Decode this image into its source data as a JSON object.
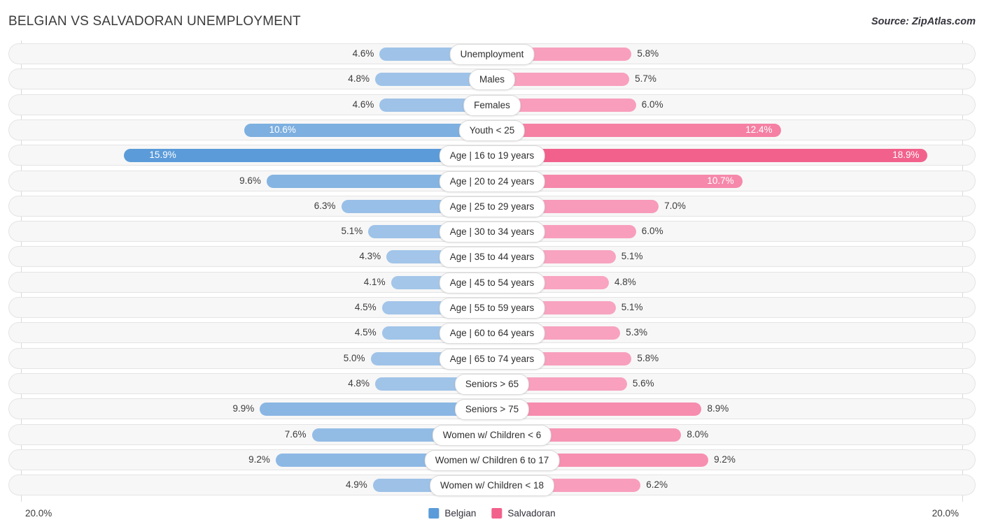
{
  "header": {
    "title": "BELGIAN VS SALVADORAN UNEMPLOYMENT",
    "source": "Source: ZipAtlas.com"
  },
  "axis": {
    "left_label": "20.0%",
    "right_label": "20.0%"
  },
  "legend": {
    "items": [
      {
        "label": "Belgian",
        "color": "#5b9bd9"
      },
      {
        "label": "Salvadoran",
        "color": "#f2618c"
      }
    ]
  },
  "colors": {
    "belgian_light": "#a8c8ea",
    "belgian_dark": "#5b9bd9",
    "salvadoran_light": "#f9a8c4",
    "salvadoran_dark": "#f2618c",
    "track": "#f7f7f7",
    "gridline": "#d8d8d8"
  },
  "chart_data": {
    "type": "bar",
    "title": "BELGIAN VS SALVADORAN UNEMPLOYMENT",
    "subtitle": "Source: ZipAtlas.com",
    "orientation": "horizontal",
    "style": "diverging-bidirectional",
    "xlabel": "",
    "ylabel": "",
    "xlim": [
      0,
      20
    ],
    "axis_ticks": [
      "20.0%",
      "20.0%"
    ],
    "grid": true,
    "legend_position": "bottom-center",
    "unit": "%",
    "max_value": 20.0,
    "categories": [
      "Unemployment",
      "Males",
      "Females",
      "Youth < 25",
      "Age | 16 to 19 years",
      "Age | 20 to 24 years",
      "Age | 25 to 29 years",
      "Age | 30 to 34 years",
      "Age | 35 to 44 years",
      "Age | 45 to 54 years",
      "Age | 55 to 59 years",
      "Age | 60 to 64 years",
      "Age | 65 to 74 years",
      "Seniors > 65",
      "Seniors > 75",
      "Women w/ Children < 6",
      "Women w/ Children 6 to 17",
      "Women w/ Children < 18"
    ],
    "series": [
      {
        "name": "Belgian",
        "color": "#5b9bd9",
        "values": [
          4.6,
          4.8,
          4.6,
          10.6,
          15.9,
          9.6,
          6.3,
          5.1,
          4.3,
          4.1,
          4.5,
          4.5,
          5.0,
          4.8,
          9.9,
          7.6,
          9.2,
          4.9
        ],
        "labels": [
          "4.6%",
          "4.8%",
          "4.6%",
          "10.6%",
          "15.9%",
          "9.6%",
          "6.3%",
          "5.1%",
          "4.3%",
          "4.1%",
          "4.5%",
          "4.5%",
          "5.0%",
          "4.8%",
          "9.9%",
          "7.6%",
          "9.2%",
          "4.9%"
        ]
      },
      {
        "name": "Salvadoran",
        "color": "#f2618c",
        "values": [
          5.8,
          5.7,
          6.0,
          12.4,
          18.9,
          10.7,
          7.0,
          6.0,
          5.1,
          4.8,
          5.1,
          5.3,
          5.8,
          5.6,
          8.9,
          8.0,
          9.2,
          6.2
        ],
        "labels": [
          "5.8%",
          "5.7%",
          "6.0%",
          "12.4%",
          "18.9%",
          "10.7%",
          "7.0%",
          "6.0%",
          "5.1%",
          "4.8%",
          "5.1%",
          "5.3%",
          "5.8%",
          "5.6%",
          "8.9%",
          "8.0%",
          "9.2%",
          "6.2%"
        ]
      }
    ]
  }
}
